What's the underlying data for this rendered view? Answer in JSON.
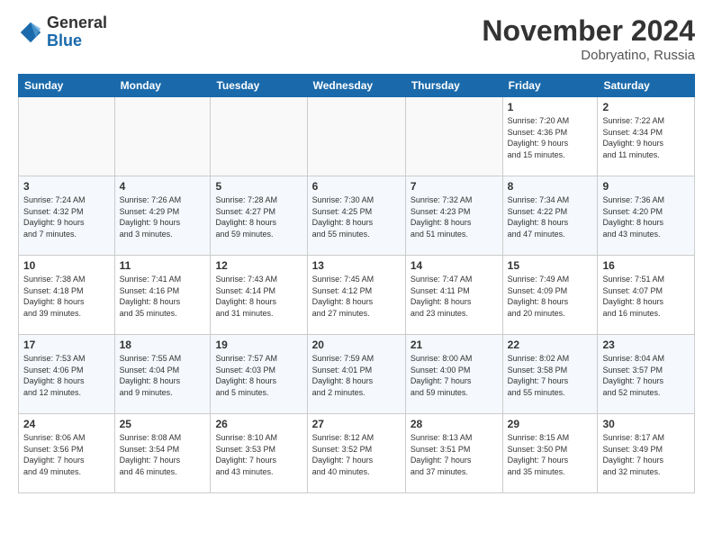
{
  "logo": {
    "general": "General",
    "blue": "Blue"
  },
  "title": {
    "month": "November 2024",
    "location": "Dobryatino, Russia"
  },
  "weekdays": [
    "Sunday",
    "Monday",
    "Tuesday",
    "Wednesday",
    "Thursday",
    "Friday",
    "Saturday"
  ],
  "weeks": [
    [
      {
        "day": "",
        "info": ""
      },
      {
        "day": "",
        "info": ""
      },
      {
        "day": "",
        "info": ""
      },
      {
        "day": "",
        "info": ""
      },
      {
        "day": "",
        "info": ""
      },
      {
        "day": "1",
        "info": "Sunrise: 7:20 AM\nSunset: 4:36 PM\nDaylight: 9 hours\nand 15 minutes."
      },
      {
        "day": "2",
        "info": "Sunrise: 7:22 AM\nSunset: 4:34 PM\nDaylight: 9 hours\nand 11 minutes."
      }
    ],
    [
      {
        "day": "3",
        "info": "Sunrise: 7:24 AM\nSunset: 4:32 PM\nDaylight: 9 hours\nand 7 minutes."
      },
      {
        "day": "4",
        "info": "Sunrise: 7:26 AM\nSunset: 4:29 PM\nDaylight: 9 hours\nand 3 minutes."
      },
      {
        "day": "5",
        "info": "Sunrise: 7:28 AM\nSunset: 4:27 PM\nDaylight: 8 hours\nand 59 minutes."
      },
      {
        "day": "6",
        "info": "Sunrise: 7:30 AM\nSunset: 4:25 PM\nDaylight: 8 hours\nand 55 minutes."
      },
      {
        "day": "7",
        "info": "Sunrise: 7:32 AM\nSunset: 4:23 PM\nDaylight: 8 hours\nand 51 minutes."
      },
      {
        "day": "8",
        "info": "Sunrise: 7:34 AM\nSunset: 4:22 PM\nDaylight: 8 hours\nand 47 minutes."
      },
      {
        "day": "9",
        "info": "Sunrise: 7:36 AM\nSunset: 4:20 PM\nDaylight: 8 hours\nand 43 minutes."
      }
    ],
    [
      {
        "day": "10",
        "info": "Sunrise: 7:38 AM\nSunset: 4:18 PM\nDaylight: 8 hours\nand 39 minutes."
      },
      {
        "day": "11",
        "info": "Sunrise: 7:41 AM\nSunset: 4:16 PM\nDaylight: 8 hours\nand 35 minutes."
      },
      {
        "day": "12",
        "info": "Sunrise: 7:43 AM\nSunset: 4:14 PM\nDaylight: 8 hours\nand 31 minutes."
      },
      {
        "day": "13",
        "info": "Sunrise: 7:45 AM\nSunset: 4:12 PM\nDaylight: 8 hours\nand 27 minutes."
      },
      {
        "day": "14",
        "info": "Sunrise: 7:47 AM\nSunset: 4:11 PM\nDaylight: 8 hours\nand 23 minutes."
      },
      {
        "day": "15",
        "info": "Sunrise: 7:49 AM\nSunset: 4:09 PM\nDaylight: 8 hours\nand 20 minutes."
      },
      {
        "day": "16",
        "info": "Sunrise: 7:51 AM\nSunset: 4:07 PM\nDaylight: 8 hours\nand 16 minutes."
      }
    ],
    [
      {
        "day": "17",
        "info": "Sunrise: 7:53 AM\nSunset: 4:06 PM\nDaylight: 8 hours\nand 12 minutes."
      },
      {
        "day": "18",
        "info": "Sunrise: 7:55 AM\nSunset: 4:04 PM\nDaylight: 8 hours\nand 9 minutes."
      },
      {
        "day": "19",
        "info": "Sunrise: 7:57 AM\nSunset: 4:03 PM\nDaylight: 8 hours\nand 5 minutes."
      },
      {
        "day": "20",
        "info": "Sunrise: 7:59 AM\nSunset: 4:01 PM\nDaylight: 8 hours\nand 2 minutes."
      },
      {
        "day": "21",
        "info": "Sunrise: 8:00 AM\nSunset: 4:00 PM\nDaylight: 7 hours\nand 59 minutes."
      },
      {
        "day": "22",
        "info": "Sunrise: 8:02 AM\nSunset: 3:58 PM\nDaylight: 7 hours\nand 55 minutes."
      },
      {
        "day": "23",
        "info": "Sunrise: 8:04 AM\nSunset: 3:57 PM\nDaylight: 7 hours\nand 52 minutes."
      }
    ],
    [
      {
        "day": "24",
        "info": "Sunrise: 8:06 AM\nSunset: 3:56 PM\nDaylight: 7 hours\nand 49 minutes."
      },
      {
        "day": "25",
        "info": "Sunrise: 8:08 AM\nSunset: 3:54 PM\nDaylight: 7 hours\nand 46 minutes."
      },
      {
        "day": "26",
        "info": "Sunrise: 8:10 AM\nSunset: 3:53 PM\nDaylight: 7 hours\nand 43 minutes."
      },
      {
        "day": "27",
        "info": "Sunrise: 8:12 AM\nSunset: 3:52 PM\nDaylight: 7 hours\nand 40 minutes."
      },
      {
        "day": "28",
        "info": "Sunrise: 8:13 AM\nSunset: 3:51 PM\nDaylight: 7 hours\nand 37 minutes."
      },
      {
        "day": "29",
        "info": "Sunrise: 8:15 AM\nSunset: 3:50 PM\nDaylight: 7 hours\nand 35 minutes."
      },
      {
        "day": "30",
        "info": "Sunrise: 8:17 AM\nSunset: 3:49 PM\nDaylight: 7 hours\nand 32 minutes."
      }
    ]
  ]
}
